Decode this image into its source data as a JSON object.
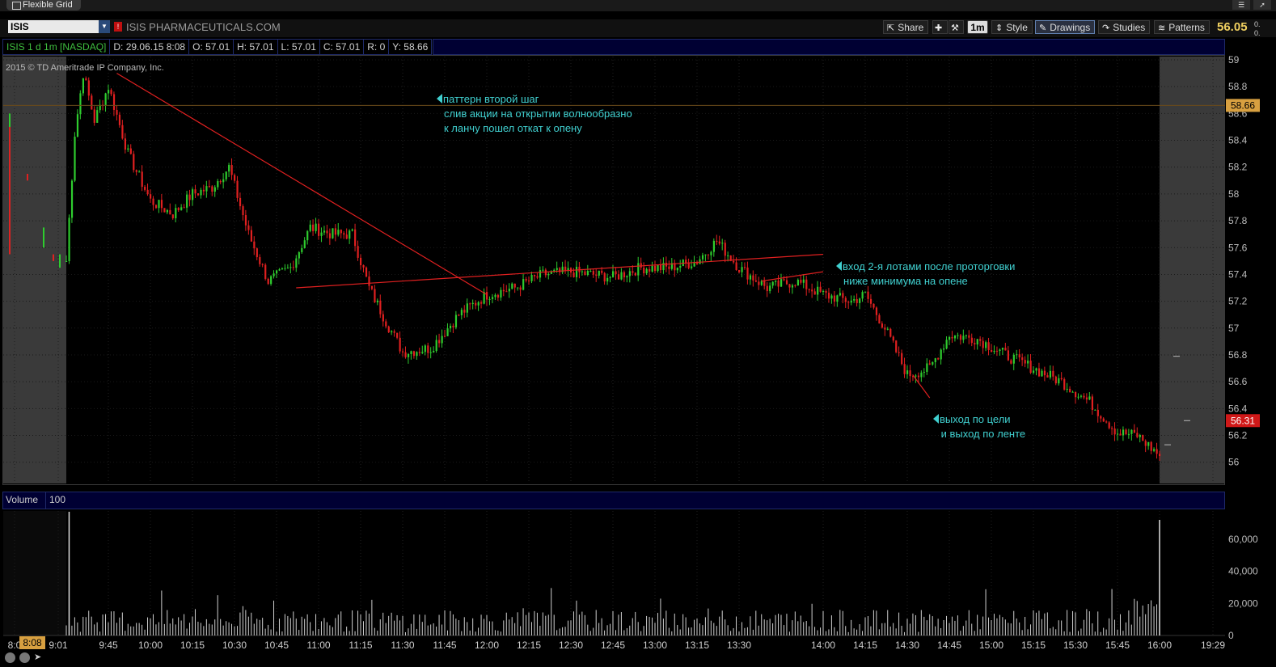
{
  "window": {
    "tab_title": "Flexible Grid"
  },
  "toolbar": {
    "symbol": "ISIS",
    "company": "ISIS PHARMACEUTICALS.COM",
    "share_label": "Share",
    "timeframe_label": "1m",
    "style_label": "Style",
    "drawings_label": "Drawings",
    "studies_label": "Studies",
    "patterns_label": "Patterns",
    "last_price": "56.05",
    "last_small_1": "0.",
    "last_small_2": "0."
  },
  "infobar": {
    "title": "ISIS 1 d 1m [NASDAQ]",
    "date": "D: 29.06.15 8:08",
    "open": "O: 57.01",
    "high": "H: 57.01",
    "low": "L: 57.01",
    "close": "C: 57.01",
    "r": "R: 0",
    "y": "Y: 58.66"
  },
  "copyright": "2015 © TD Ameritrade IP Company, Inc.",
  "volume_panel": {
    "label": "Volume",
    "value": "100"
  },
  "annotations": [
    {
      "lines": [
        "паттерн второй шаг",
        "слив акции на открытии волнообразно",
        "к ланчу пошел откат к опену"
      ]
    },
    {
      "lines": [
        "вход 2-я лотами  после проторговки",
        "ниже минимума на опене"
      ]
    },
    {
      "lines": [
        "выход по цели",
        " и выход по ленте"
      ]
    }
  ],
  "time_badge": "8:08",
  "colors": {
    "up": "#2ecc2e",
    "down": "#e02020",
    "trend": "#e02020",
    "price_tag": "#d8a040",
    "last_tag": "#d01818",
    "ann": "#40d0d0"
  },
  "chart_data": [
    {
      "type": "candlestick",
      "title": "ISIS 1 d 1m [NASDAQ]",
      "x_tick_labels": [
        "8:0",
        "9:01",
        "9:45",
        "10:00",
        "10:15",
        "10:30",
        "10:45",
        "11:00",
        "11:15",
        "11:30",
        "11:45",
        "12:00",
        "12:15",
        "12:30",
        "12:45",
        "13:00",
        "13:15",
        "13:30",
        "14:00",
        "14:15",
        "14:30",
        "14:45",
        "15:00",
        "15:15",
        "15:30",
        "15:45",
        "16:00",
        "19:29"
      ],
      "y_tick_labels": [
        "59",
        "58.8",
        "58.6",
        "58.4",
        "58.2",
        "58",
        "57.8",
        "57.6",
        "57.4",
        "57.2",
        "57",
        "56.8",
        "56.6",
        "56.4",
        "56.2",
        "56"
      ],
      "ylim": [
        55.95,
        59.0
      ],
      "price_tags": [
        {
          "label": "58.66",
          "value": 58.66
        },
        {
          "label": "56.31",
          "value": 56.31
        }
      ],
      "session_close_path": [
        [
          "9:30",
          57.5
        ],
        [
          "9:33",
          58.45
        ],
        [
          "9:36",
          58.9
        ],
        [
          "9:40",
          58.55
        ],
        [
          "9:45",
          58.8
        ],
        [
          "9:52",
          58.3
        ],
        [
          "10:00",
          57.95
        ],
        [
          "10:08",
          57.85
        ],
        [
          "10:15",
          58.0
        ],
        [
          "10:22",
          58.05
        ],
        [
          "10:28",
          58.2
        ],
        [
          "10:35",
          57.7
        ],
        [
          "10:42",
          57.35
        ],
        [
          "10:50",
          57.45
        ],
        [
          "10:57",
          57.75
        ],
        [
          "11:05",
          57.7
        ],
        [
          "11:12",
          57.7
        ],
        [
          "11:18",
          57.3
        ],
        [
          "11:24",
          57.05
        ],
        [
          "11:30",
          56.82
        ],
        [
          "11:40",
          56.85
        ],
        [
          "11:50",
          57.1
        ],
        [
          "12:00",
          57.25
        ],
        [
          "12:10",
          57.3
        ],
        [
          "12:20",
          57.4
        ],
        [
          "12:30",
          57.42
        ],
        [
          "12:45",
          57.38
        ],
        [
          "12:55",
          57.45
        ],
        [
          "13:05",
          57.45
        ],
        [
          "13:15",
          57.5
        ],
        [
          "13:22",
          57.65
        ],
        [
          "13:30",
          57.45
        ],
        [
          "13:40",
          57.3
        ],
        [
          "13:50",
          57.35
        ],
        [
          "14:00",
          57.25
        ],
        [
          "14:10",
          57.2
        ],
        [
          "14:15",
          57.25
        ],
        [
          "14:22",
          57.0
        ],
        [
          "14:30",
          56.65
        ],
        [
          "14:38",
          56.7
        ],
        [
          "14:45",
          56.95
        ],
        [
          "14:55",
          56.92
        ],
        [
          "15:05",
          56.8
        ],
        [
          "15:15",
          56.7
        ],
        [
          "15:25",
          56.6
        ],
        [
          "15:35",
          56.45
        ],
        [
          "15:45",
          56.22
        ],
        [
          "15:52",
          56.2
        ],
        [
          "16:00",
          56.05
        ]
      ],
      "trendlines": [
        {
          "from": [
            "9:48",
            58.9
          ],
          "to": [
            "12:00",
            57.25
          ]
        },
        {
          "from": [
            "10:52",
            57.3
          ],
          "to": [
            "14:00",
            57.55
          ]
        },
        {
          "from": [
            "13:38",
            57.35
          ],
          "to": [
            "14:00",
            57.42
          ]
        },
        {
          "from": [
            "14:32",
            56.65
          ],
          "to": [
            "14:38",
            56.48
          ]
        }
      ]
    },
    {
      "type": "bar",
      "title": "Volume",
      "y_tick_labels": [
        "60,000",
        "40,000",
        "20,000",
        "0"
      ],
      "ylim": [
        0,
        70000
      ],
      "notable_bars": [
        {
          "x": "9:31",
          "value": 78000
        },
        {
          "x": "16:00",
          "value": 72000
        }
      ]
    }
  ]
}
